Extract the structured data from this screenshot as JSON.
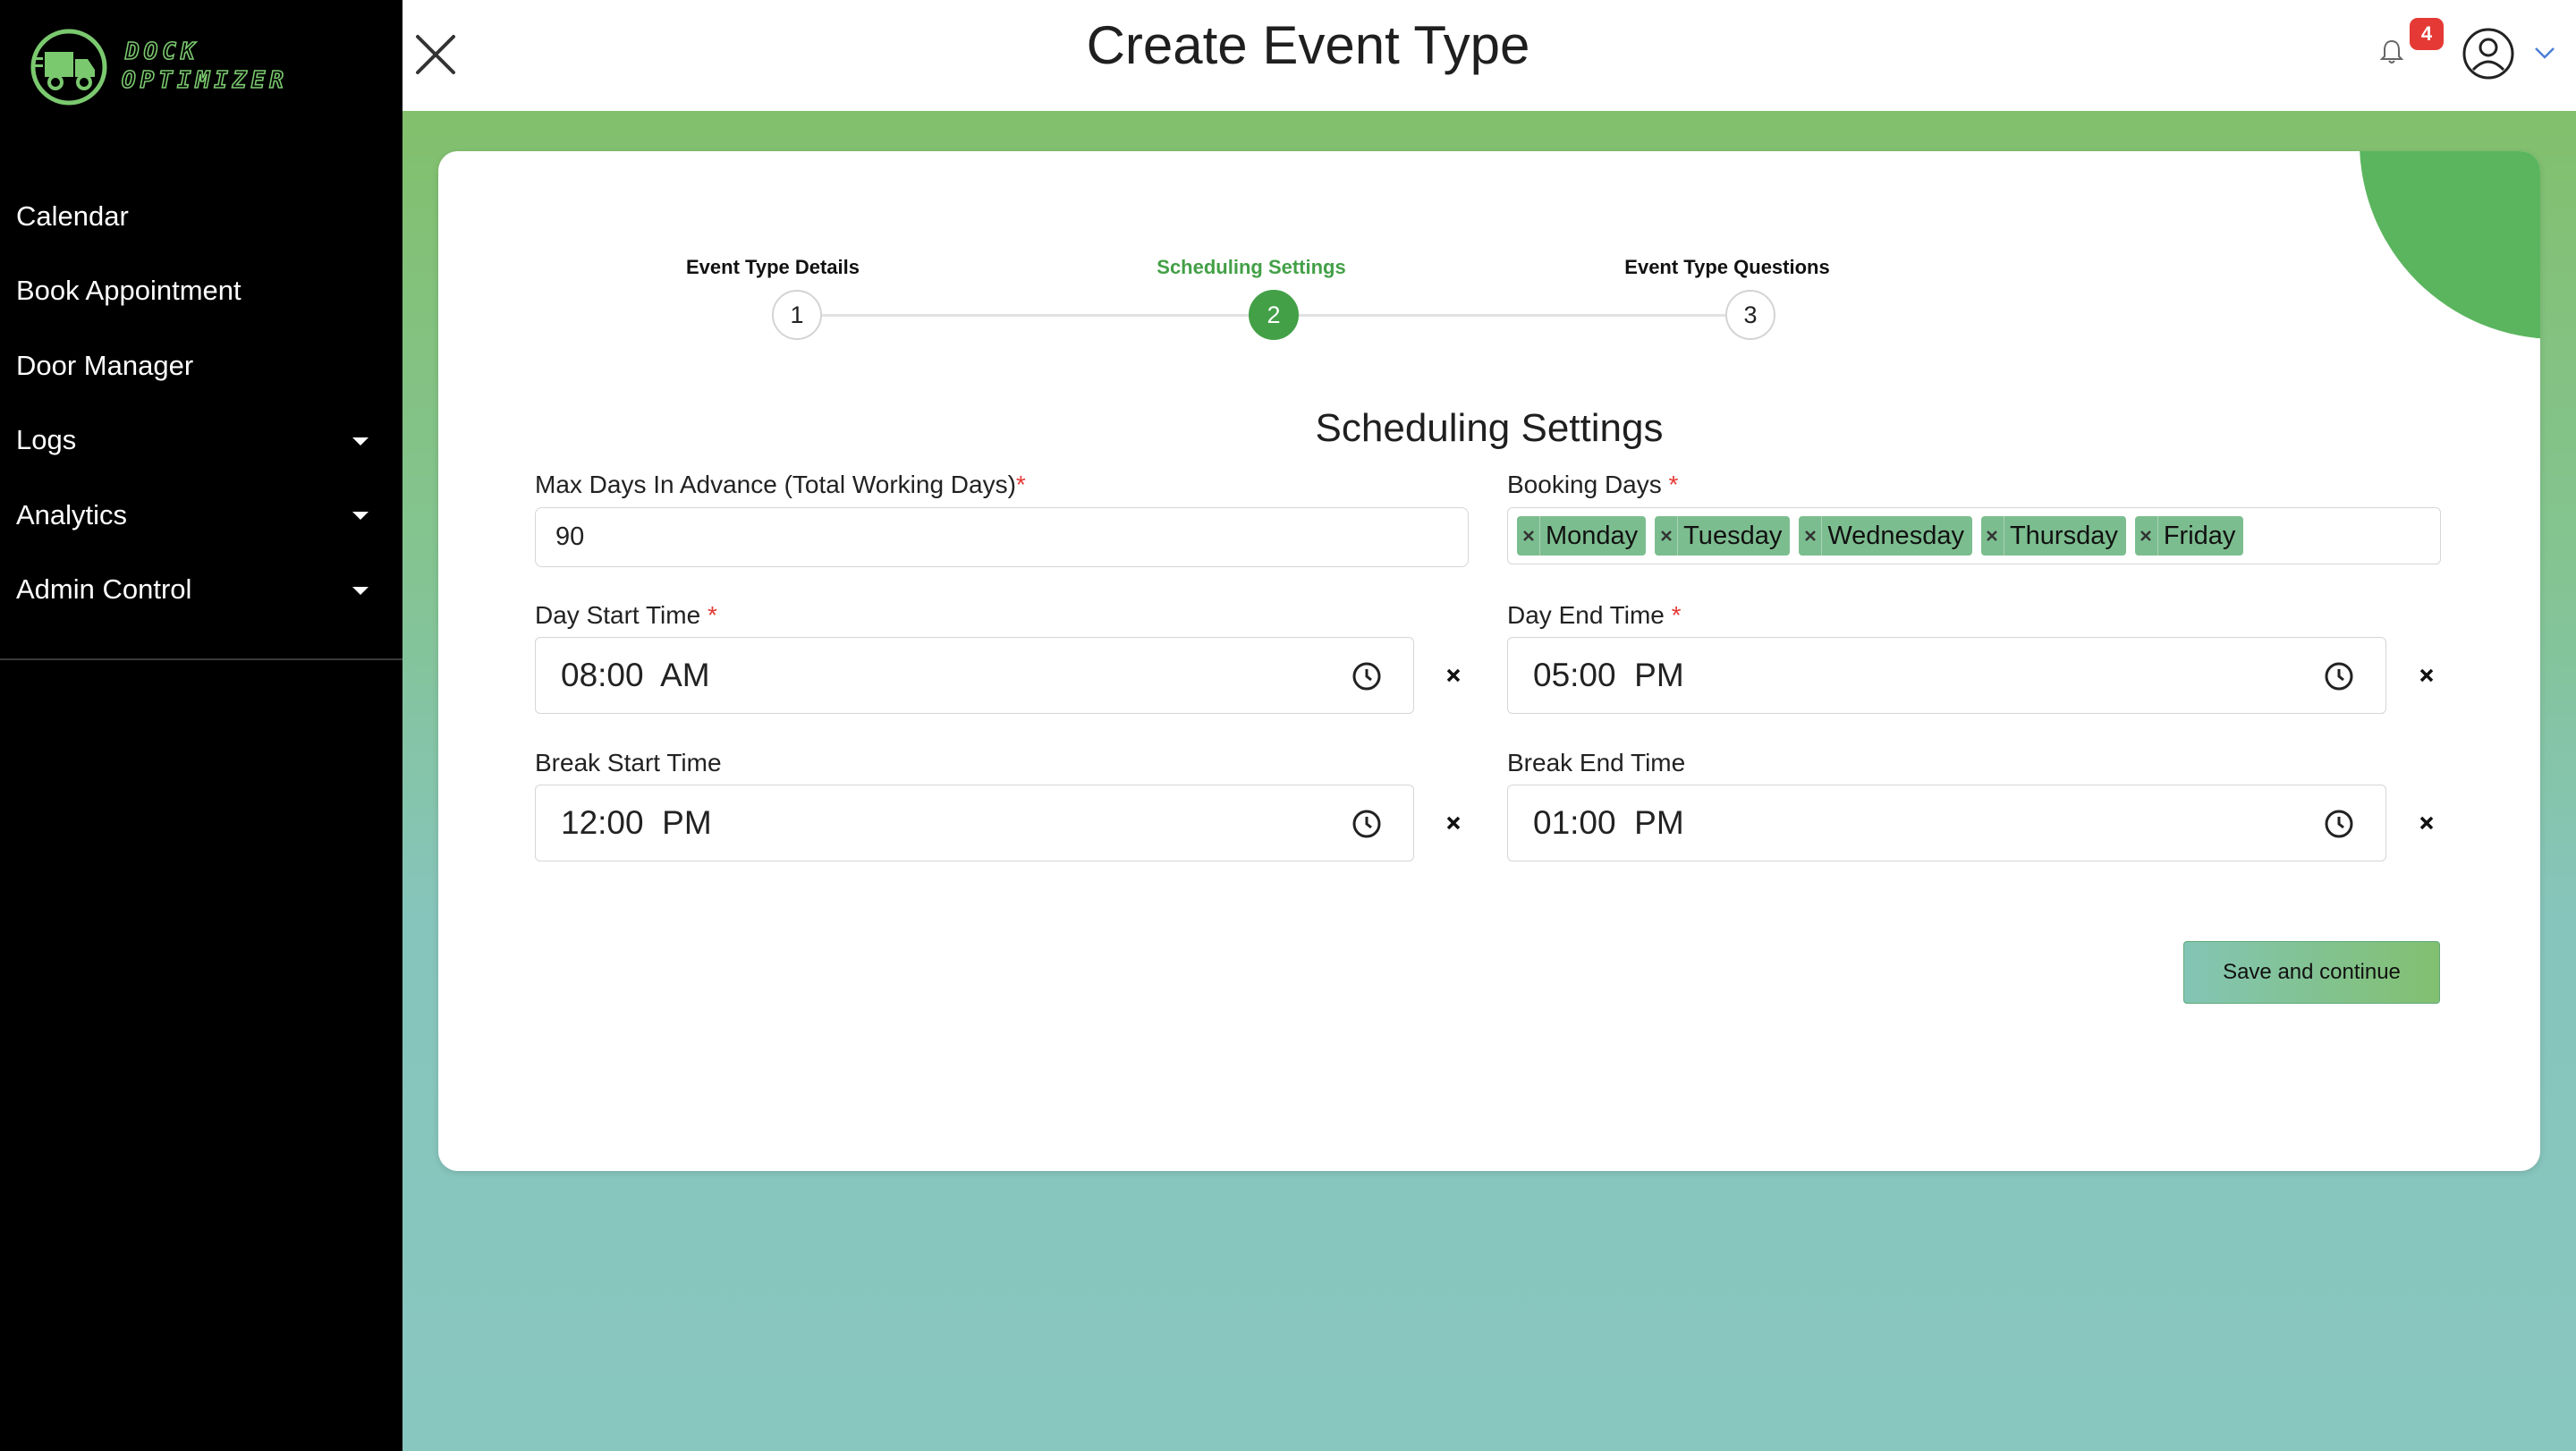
{
  "brand": {
    "logo_line1": "DOCK",
    "logo_line2": "OPTIMIZER",
    "accent_color": "#7bc96f"
  },
  "sidebar": {
    "items": [
      {
        "label": "Calendar",
        "has_dropdown": false
      },
      {
        "label": "Book Appointment",
        "has_dropdown": false
      },
      {
        "label": "Door Manager",
        "has_dropdown": false
      },
      {
        "label": "Logs",
        "has_dropdown": true
      },
      {
        "label": "Analytics",
        "has_dropdown": true
      },
      {
        "label": "Admin Control",
        "has_dropdown": true
      }
    ]
  },
  "header": {
    "title": "Create Event Type",
    "notification_count": "4",
    "icons": [
      "close-icon",
      "bell-icon",
      "user-avatar-icon",
      "chevron-down-icon"
    ]
  },
  "stepper": {
    "steps": [
      {
        "label": "Event Type Details",
        "number": "1",
        "active": false
      },
      {
        "label": "Scheduling Settings",
        "number": "2",
        "active": true
      },
      {
        "label": "Event Type Questions",
        "number": "3",
        "active": false
      }
    ],
    "active_color": "#43a047"
  },
  "form": {
    "section_title": "Scheduling Settings",
    "max_days": {
      "label": "Max Days In Advance (Total Working Days)",
      "required_mark": "*",
      "value": "90"
    },
    "booking_days": {
      "label": "Booking Days",
      "required_mark": "*",
      "tags": [
        "Monday",
        "Tuesday",
        "Wednesday",
        "Thursday",
        "Friday"
      ]
    },
    "day_start": {
      "label": "Day Start Time",
      "required_mark": "*",
      "value": "08:00  AM"
    },
    "day_end": {
      "label": "Day End Time",
      "required_mark": "*",
      "value": "05:00  PM"
    },
    "break_start": {
      "label": "Break Start Time",
      "value": "12:00  PM"
    },
    "break_end": {
      "label": "Break End Time",
      "value": "01:00  PM"
    },
    "save_label": "Save and continue"
  }
}
